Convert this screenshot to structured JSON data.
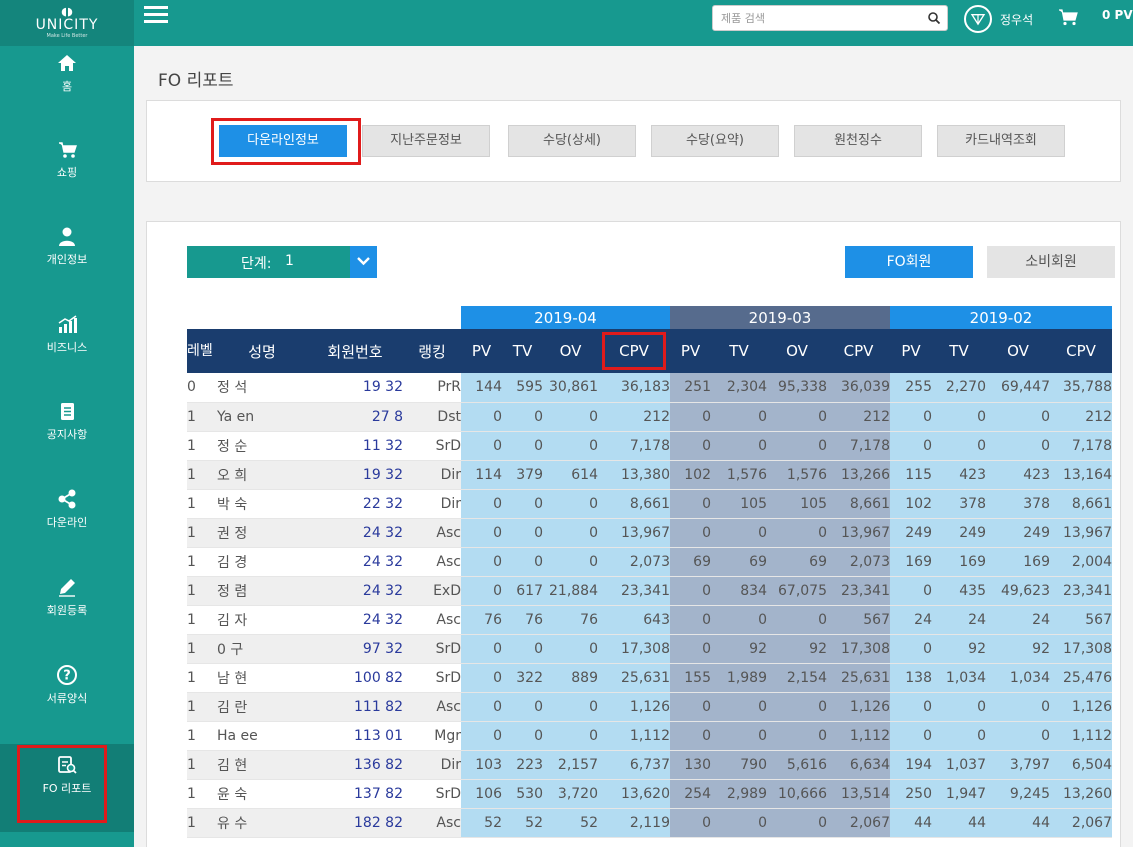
{
  "brand": {
    "name": "UNICITY",
    "tagline": "Make Life Better"
  },
  "sidebar": {
    "items": [
      {
        "label": "홈",
        "icon": "home-icon"
      },
      {
        "label": "쇼핑",
        "icon": "cart-icon"
      },
      {
        "label": "개인정보",
        "icon": "person-icon"
      },
      {
        "label": "비즈니스",
        "icon": "bar-chart-icon"
      },
      {
        "label": "공지사항",
        "icon": "notice-icon"
      },
      {
        "label": "다운라인",
        "icon": "network-icon"
      },
      {
        "label": "회원등록",
        "icon": "pencil-icon"
      },
      {
        "label": "서류양식",
        "icon": "question-icon"
      },
      {
        "label": "FO 리포트",
        "icon": "report-icon",
        "active": true
      }
    ]
  },
  "topbar": {
    "search_placeholder": "제품 검색",
    "user_name": "정우석",
    "pv": "0 PV"
  },
  "main": {
    "title": "FO 리포트",
    "tabs": [
      "다운라인정보",
      "지난주문정보",
      "수당(상세)",
      "수당(요약)",
      "원천징수",
      "카드내역조회"
    ],
    "level_label": "단계:",
    "level_value": "1",
    "fo_button": "FO회원",
    "consumer_button": "소비회원"
  },
  "table": {
    "months": [
      "2019-04",
      "2019-03",
      "2019-02"
    ],
    "headers": {
      "level": "레벨",
      "name": "성명",
      "id": "회원번호",
      "rank": "랭킹",
      "metrics": [
        "PV",
        "TV",
        "OV",
        "CPV"
      ]
    },
    "rows": [
      {
        "level": "0",
        "name": "정      석",
        "id": "19       32",
        "rank": "PrR",
        "m": [
          [
            "144",
            "595",
            "30,861",
            "36,183"
          ],
          [
            "251",
            "2,304",
            "95,338",
            "36,039"
          ],
          [
            "255",
            "2,270",
            "69,447",
            "35,788"
          ]
        ]
      },
      {
        "level": "1",
        "name": "Ya          en",
        "id": "27        8",
        "rank": "Dst",
        "m": [
          [
            "0",
            "0",
            "0",
            "212"
          ],
          [
            "0",
            "0",
            "0",
            "212"
          ],
          [
            "0",
            "0",
            "0",
            "212"
          ]
        ]
      },
      {
        "level": "1",
        "name": "정      순",
        "id": "11       32",
        "rank": "SrD",
        "m": [
          [
            "0",
            "0",
            "0",
            "7,178"
          ],
          [
            "0",
            "0",
            "0",
            "7,178"
          ],
          [
            "0",
            "0",
            "0",
            "7,178"
          ]
        ]
      },
      {
        "level": "1",
        "name": "오      희",
        "id": "19       32",
        "rank": "Dir",
        "m": [
          [
            "114",
            "379",
            "614",
            "13,380"
          ],
          [
            "102",
            "1,576",
            "1,576",
            "13,266"
          ],
          [
            "115",
            "423",
            "423",
            "13,164"
          ]
        ]
      },
      {
        "level": "1",
        "name": "박      숙",
        "id": "22       32",
        "rank": "Dir",
        "m": [
          [
            "0",
            "0",
            "0",
            "8,661"
          ],
          [
            "0",
            "105",
            "105",
            "8,661"
          ],
          [
            "102",
            "378",
            "378",
            "8,661"
          ]
        ]
      },
      {
        "level": "1",
        "name": "권      정",
        "id": "24       32",
        "rank": "Asc",
        "m": [
          [
            "0",
            "0",
            "0",
            "13,967"
          ],
          [
            "0",
            "0",
            "0",
            "13,967"
          ],
          [
            "249",
            "249",
            "249",
            "13,967"
          ]
        ]
      },
      {
        "level": "1",
        "name": "김      경",
        "id": "24       32",
        "rank": "Asc",
        "m": [
          [
            "0",
            "0",
            "0",
            "2,073"
          ],
          [
            "69",
            "69",
            "69",
            "2,073"
          ],
          [
            "169",
            "169",
            "169",
            "2,004"
          ]
        ]
      },
      {
        "level": "1",
        "name": "정      렴",
        "id": "24       32",
        "rank": "ExD",
        "m": [
          [
            "0",
            "617",
            "21,884",
            "23,341"
          ],
          [
            "0",
            "834",
            "67,075",
            "23,341"
          ],
          [
            "0",
            "435",
            "49,623",
            "23,341"
          ]
        ]
      },
      {
        "level": "1",
        "name": "김      자",
        "id": "24       32",
        "rank": "Asc",
        "m": [
          [
            "76",
            "76",
            "76",
            "643"
          ],
          [
            "0",
            "0",
            "0",
            "567"
          ],
          [
            "24",
            "24",
            "24",
            "567"
          ]
        ]
      },
      {
        "level": "1",
        "name": "0       구",
        "id": "97       32",
        "rank": "SrD",
        "m": [
          [
            "0",
            "0",
            "0",
            "17,308"
          ],
          [
            "0",
            "92",
            "92",
            "17,308"
          ],
          [
            "0",
            "92",
            "92",
            "17,308"
          ]
        ]
      },
      {
        "level": "1",
        "name": "남      현",
        "id": "100       82",
        "rank": "SrD",
        "m": [
          [
            "0",
            "322",
            "889",
            "25,631"
          ],
          [
            "155",
            "1,989",
            "2,154",
            "25,631"
          ],
          [
            "138",
            "1,034",
            "1,034",
            "25,476"
          ]
        ]
      },
      {
        "level": "1",
        "name": "김      란",
        "id": "111       82",
        "rank": "Asc",
        "m": [
          [
            "0",
            "0",
            "0",
            "1,126"
          ],
          [
            "0",
            "0",
            "0",
            "1,126"
          ],
          [
            "0",
            "0",
            "0",
            "1,126"
          ]
        ]
      },
      {
        "level": "1",
        "name": "Ha              ee",
        "id": "113       01",
        "rank": "Mgr",
        "m": [
          [
            "0",
            "0",
            "0",
            "1,112"
          ],
          [
            "0",
            "0",
            "0",
            "1,112"
          ],
          [
            "0",
            "0",
            "0",
            "1,112"
          ]
        ]
      },
      {
        "level": "1",
        "name": "김      현",
        "id": "136       82",
        "rank": "Dir",
        "m": [
          [
            "103",
            "223",
            "2,157",
            "6,737"
          ],
          [
            "130",
            "790",
            "5,616",
            "6,634"
          ],
          [
            "194",
            "1,037",
            "3,797",
            "6,504"
          ]
        ]
      },
      {
        "level": "1",
        "name": "윤      숙",
        "id": "137       82",
        "rank": "SrD",
        "m": [
          [
            "106",
            "530",
            "3,720",
            "13,620"
          ],
          [
            "254",
            "2,989",
            "10,666",
            "13,514"
          ],
          [
            "250",
            "1,947",
            "9,245",
            "13,260"
          ]
        ]
      },
      {
        "level": "1",
        "name": "유      수",
        "id": "182       82",
        "rank": "Asc",
        "m": [
          [
            "52",
            "52",
            "52",
            "2,119"
          ],
          [
            "0",
            "0",
            "0",
            "2,067"
          ],
          [
            "44",
            "44",
            "44",
            "2,067"
          ]
        ]
      }
    ]
  },
  "colors": {
    "teal": "#17998f",
    "blue": "#1e90e6",
    "navy": "#1a3d6e",
    "highlight": "#e01b1b"
  }
}
